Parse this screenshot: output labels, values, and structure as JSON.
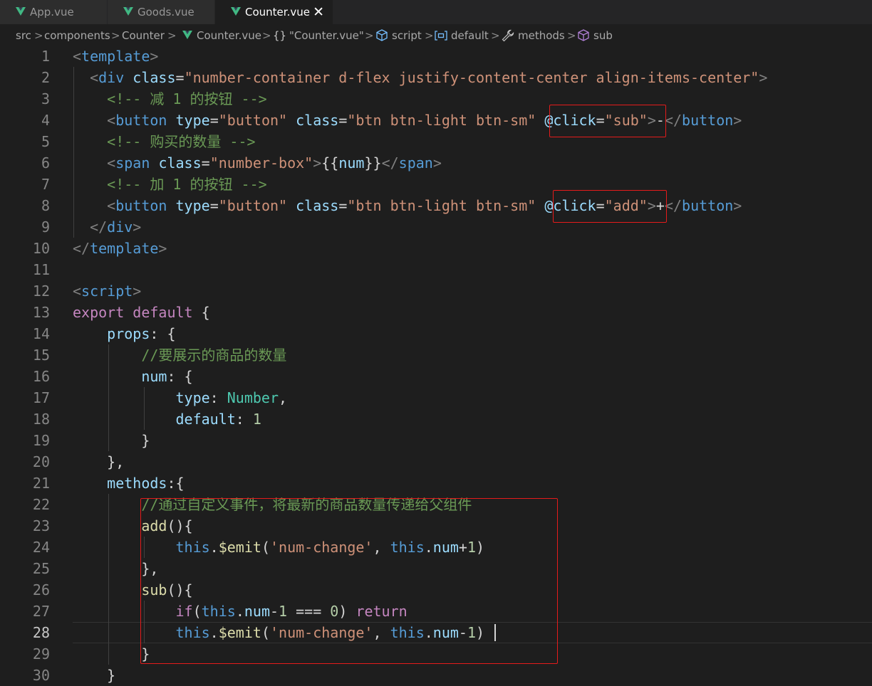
{
  "tabs": [
    {
      "label": "App.vue",
      "icon": "vue-logo-icon",
      "active": false
    },
    {
      "label": "Goods.vue",
      "icon": "vue-logo-icon",
      "active": false
    },
    {
      "label": "Counter.vue",
      "icon": "vue-logo-icon",
      "active": true,
      "close": "✕"
    }
  ],
  "breadcrumb": {
    "src": "src",
    "components": "components",
    "folder": "Counter",
    "file": "Counter.vue",
    "module": "\"Counter.vue\"",
    "module_icon": "{}",
    "script": "script",
    "default": "default",
    "methods": "methods",
    "sub": "sub",
    "separator": ">"
  },
  "colors": {
    "background": "#1e1e1e",
    "tag": "#569cd6",
    "attribute": "#9cdcfe",
    "string": "#ce9178",
    "comment": "#6a9955",
    "keyword": "#c586c0",
    "function": "#dcdcaa",
    "number": "#b5cea8",
    "highlight_box": "#e51b1b"
  },
  "editor": {
    "current_line": 28,
    "line_numbers": [
      "1",
      "2",
      "3",
      "4",
      "5",
      "6",
      "7",
      "8",
      "9",
      "10",
      "11",
      "12",
      "13",
      "14",
      "15",
      "16",
      "17",
      "18",
      "19",
      "20",
      "21",
      "22",
      "23",
      "24",
      "25",
      "26",
      "27",
      "28",
      "29",
      "30"
    ],
    "lines": [
      [
        [
          "t",
          "<"
        ],
        [
          "tag",
          "template"
        ],
        [
          "t",
          ">"
        ]
      ],
      [
        [
          "t",
          "  <"
        ],
        [
          "tag",
          "div"
        ],
        [
          "txt",
          " "
        ],
        [
          "attr",
          "class"
        ],
        [
          "txt",
          "="
        ],
        [
          "str",
          "\"number-container d-flex justify-content-center align-items-center\""
        ],
        [
          "t",
          ">"
        ]
      ],
      [
        [
          "cm",
          "    <!-- 减 1 的按钮 -->"
        ]
      ],
      [
        [
          "t",
          "    <"
        ],
        [
          "tag",
          "button"
        ],
        [
          "txt",
          " "
        ],
        [
          "attr",
          "type"
        ],
        [
          "txt",
          "="
        ],
        [
          "str",
          "\"button\""
        ],
        [
          "txt",
          " "
        ],
        [
          "attr",
          "class"
        ],
        [
          "txt",
          "="
        ],
        [
          "str",
          "\"btn btn-light btn-sm\""
        ],
        [
          "txt",
          " "
        ],
        [
          "attr",
          "@click"
        ],
        [
          "txt",
          "="
        ],
        [
          "str",
          "\"sub\""
        ],
        [
          "t",
          ">"
        ],
        [
          "txt",
          "-"
        ],
        [
          "t",
          "</"
        ],
        [
          "tag",
          "button"
        ],
        [
          "t",
          ">"
        ]
      ],
      [
        [
          "cm",
          "    <!-- 购买的数量 -->"
        ]
      ],
      [
        [
          "t",
          "    <"
        ],
        [
          "tag",
          "span"
        ],
        [
          "txt",
          " "
        ],
        [
          "attr",
          "class"
        ],
        [
          "txt",
          "="
        ],
        [
          "str",
          "\"number-box\""
        ],
        [
          "t",
          ">"
        ],
        [
          "txt",
          "{{"
        ],
        [
          "attr",
          "num"
        ],
        [
          "txt",
          "}}"
        ],
        [
          "t",
          "</"
        ],
        [
          "tag",
          "span"
        ],
        [
          "t",
          ">"
        ]
      ],
      [
        [
          "cm",
          "    <!-- 加 1 的按钮 -->"
        ]
      ],
      [
        [
          "t",
          "    <"
        ],
        [
          "tag",
          "button"
        ],
        [
          "txt",
          " "
        ],
        [
          "attr",
          "type"
        ],
        [
          "txt",
          "="
        ],
        [
          "str",
          "\"button\""
        ],
        [
          "txt",
          " "
        ],
        [
          "attr",
          "class"
        ],
        [
          "txt",
          "="
        ],
        [
          "str",
          "\"btn btn-light btn-sm\""
        ],
        [
          "txt",
          " "
        ],
        [
          "attr",
          "@click"
        ],
        [
          "txt",
          "="
        ],
        [
          "str",
          "\"add\""
        ],
        [
          "t",
          ">"
        ],
        [
          "txt",
          "+"
        ],
        [
          "t",
          "</"
        ],
        [
          "tag",
          "button"
        ],
        [
          "t",
          ">"
        ]
      ],
      [
        [
          "t",
          "  </"
        ],
        [
          "tag",
          "div"
        ],
        [
          "t",
          ">"
        ]
      ],
      [
        [
          "t",
          "</"
        ],
        [
          "tag",
          "template"
        ],
        [
          "t",
          ">"
        ]
      ],
      [],
      [
        [
          "t",
          "<"
        ],
        [
          "tag",
          "script"
        ],
        [
          "t",
          ">"
        ]
      ],
      [
        [
          "kw",
          "export"
        ],
        [
          "txt",
          " "
        ],
        [
          "kw",
          "default"
        ],
        [
          "txt",
          " {"
        ]
      ],
      [
        [
          "txt",
          "    "
        ],
        [
          "attr",
          "props"
        ],
        [
          "txt",
          ": {"
        ]
      ],
      [
        [
          "cm",
          "        //要展示的商品的数量"
        ]
      ],
      [
        [
          "txt",
          "        "
        ],
        [
          "attr",
          "num"
        ],
        [
          "txt",
          ": {"
        ]
      ],
      [
        [
          "txt",
          "            "
        ],
        [
          "attr",
          "type"
        ],
        [
          "txt",
          ": "
        ],
        [
          "typ",
          "Number"
        ],
        [
          "txt",
          ","
        ]
      ],
      [
        [
          "txt",
          "            "
        ],
        [
          "attr",
          "default"
        ],
        [
          "txt",
          ": "
        ],
        [
          "num",
          "1"
        ]
      ],
      [
        [
          "txt",
          "        }"
        ]
      ],
      [
        [
          "txt",
          "    },"
        ]
      ],
      [
        [
          "txt",
          "    "
        ],
        [
          "attr",
          "methods"
        ],
        [
          "txt",
          ":{"
        ]
      ],
      [
        [
          "cm",
          "        //通过自定义事件，将最新的商品数量传递给父组件"
        ]
      ],
      [
        [
          "txt",
          "        "
        ],
        [
          "fn",
          "add"
        ],
        [
          "txt",
          "(){"
        ]
      ],
      [
        [
          "txt",
          "            "
        ],
        [
          "bl",
          "this"
        ],
        [
          "txt",
          "."
        ],
        [
          "fn",
          "$emit"
        ],
        [
          "txt",
          "("
        ],
        [
          "str",
          "'num-change'"
        ],
        [
          "txt",
          ", "
        ],
        [
          "bl",
          "this"
        ],
        [
          "txt",
          "."
        ],
        [
          "attr",
          "num"
        ],
        [
          "txt",
          "+"
        ],
        [
          "num",
          "1"
        ],
        [
          "txt",
          ")"
        ]
      ],
      [
        [
          "txt",
          "        },"
        ]
      ],
      [
        [
          "txt",
          "        "
        ],
        [
          "fn",
          "sub"
        ],
        [
          "txt",
          "(){"
        ]
      ],
      [
        [
          "txt",
          "            "
        ],
        [
          "kw",
          "if"
        ],
        [
          "txt",
          "("
        ],
        [
          "bl",
          "this"
        ],
        [
          "txt",
          "."
        ],
        [
          "attr",
          "num"
        ],
        [
          "txt",
          "-"
        ],
        [
          "num",
          "1"
        ],
        [
          "txt",
          " === "
        ],
        [
          "num",
          "0"
        ],
        [
          "txt",
          ") "
        ],
        [
          "kw",
          "return"
        ]
      ],
      [
        [
          "txt",
          "            "
        ],
        [
          "bl",
          "this"
        ],
        [
          "txt",
          "."
        ],
        [
          "fn",
          "$emit"
        ],
        [
          "txt",
          "("
        ],
        [
          "str",
          "'num-change'"
        ],
        [
          "txt",
          ", "
        ],
        [
          "bl",
          "this"
        ],
        [
          "txt",
          "."
        ],
        [
          "attr",
          "num"
        ],
        [
          "txt",
          "-"
        ],
        [
          "num",
          "1"
        ],
        [
          "txt",
          ")"
        ]
      ],
      [
        [
          "txt",
          "        }"
        ]
      ],
      [
        [
          "txt",
          "    }"
        ]
      ]
    ]
  }
}
